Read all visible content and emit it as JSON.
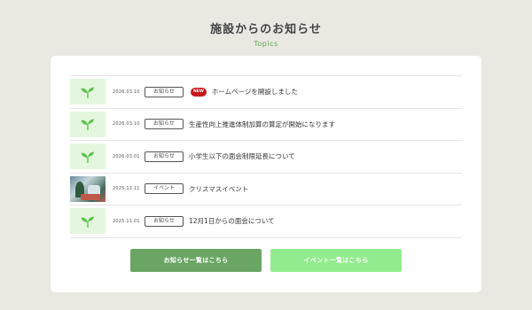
{
  "section": {
    "title": "施設からのお知らせ",
    "subtitle": "Topics"
  },
  "colors": {
    "background": "#e9e8e1",
    "accent_green": "#6aa564",
    "light_green": "#92ec8d",
    "new_badge": "#c8161d",
    "thumb_bg": "#e4f7de"
  },
  "items": [
    {
      "thumb": "sprout-icon",
      "date": "2026.03.10",
      "category": "お知らせ",
      "new_badge": "NEW",
      "title": "ホームページを開設しました"
    },
    {
      "thumb": "sprout-icon",
      "date": "2026.03.10",
      "category": "お知らせ",
      "title": "生産性向上推進体制加算の算定が開始になります"
    },
    {
      "thumb": "sprout-icon",
      "date": "2026.03.01",
      "category": "お知らせ",
      "title": "小学生以下の面会制限延長について"
    },
    {
      "thumb": "photo",
      "date": "2025.12.11",
      "category": "イベント",
      "title": "クリスマスイベント"
    },
    {
      "thumb": "sprout-icon",
      "date": "2025.11.01",
      "category": "お知らせ",
      "title": "12月1日からの面会について"
    }
  ],
  "buttons": {
    "news_list": "お知らせ一覧はこちら",
    "event_list": "イベント一覧はこちら"
  }
}
